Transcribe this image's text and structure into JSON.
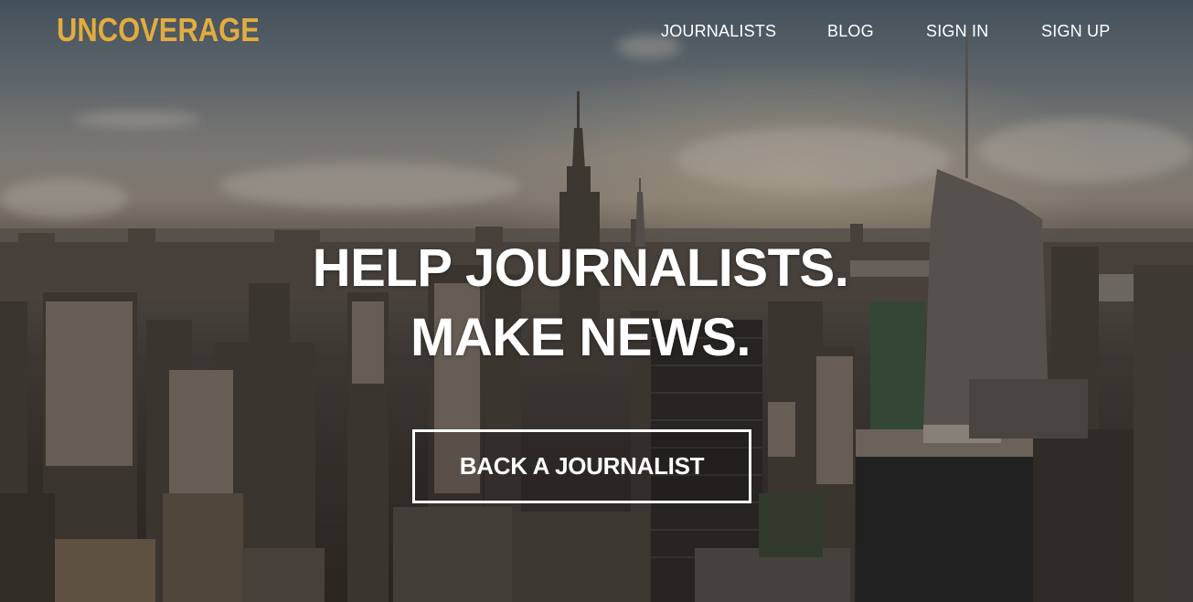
{
  "brand": {
    "logo_text": "UNCOVERAGE",
    "logo_color": "#e2ac3f"
  },
  "nav": {
    "items": [
      {
        "label": "JOURNALISTS"
      },
      {
        "label": "BLOG"
      },
      {
        "label": "SIGN IN"
      },
      {
        "label": "SIGN UP"
      }
    ]
  },
  "hero": {
    "headline_line1": "HELP JOURNALISTS.",
    "headline_line2": "MAKE NEWS.",
    "cta_label": "BACK A JOURNALIST",
    "background": "city skyline photo (New York)"
  }
}
